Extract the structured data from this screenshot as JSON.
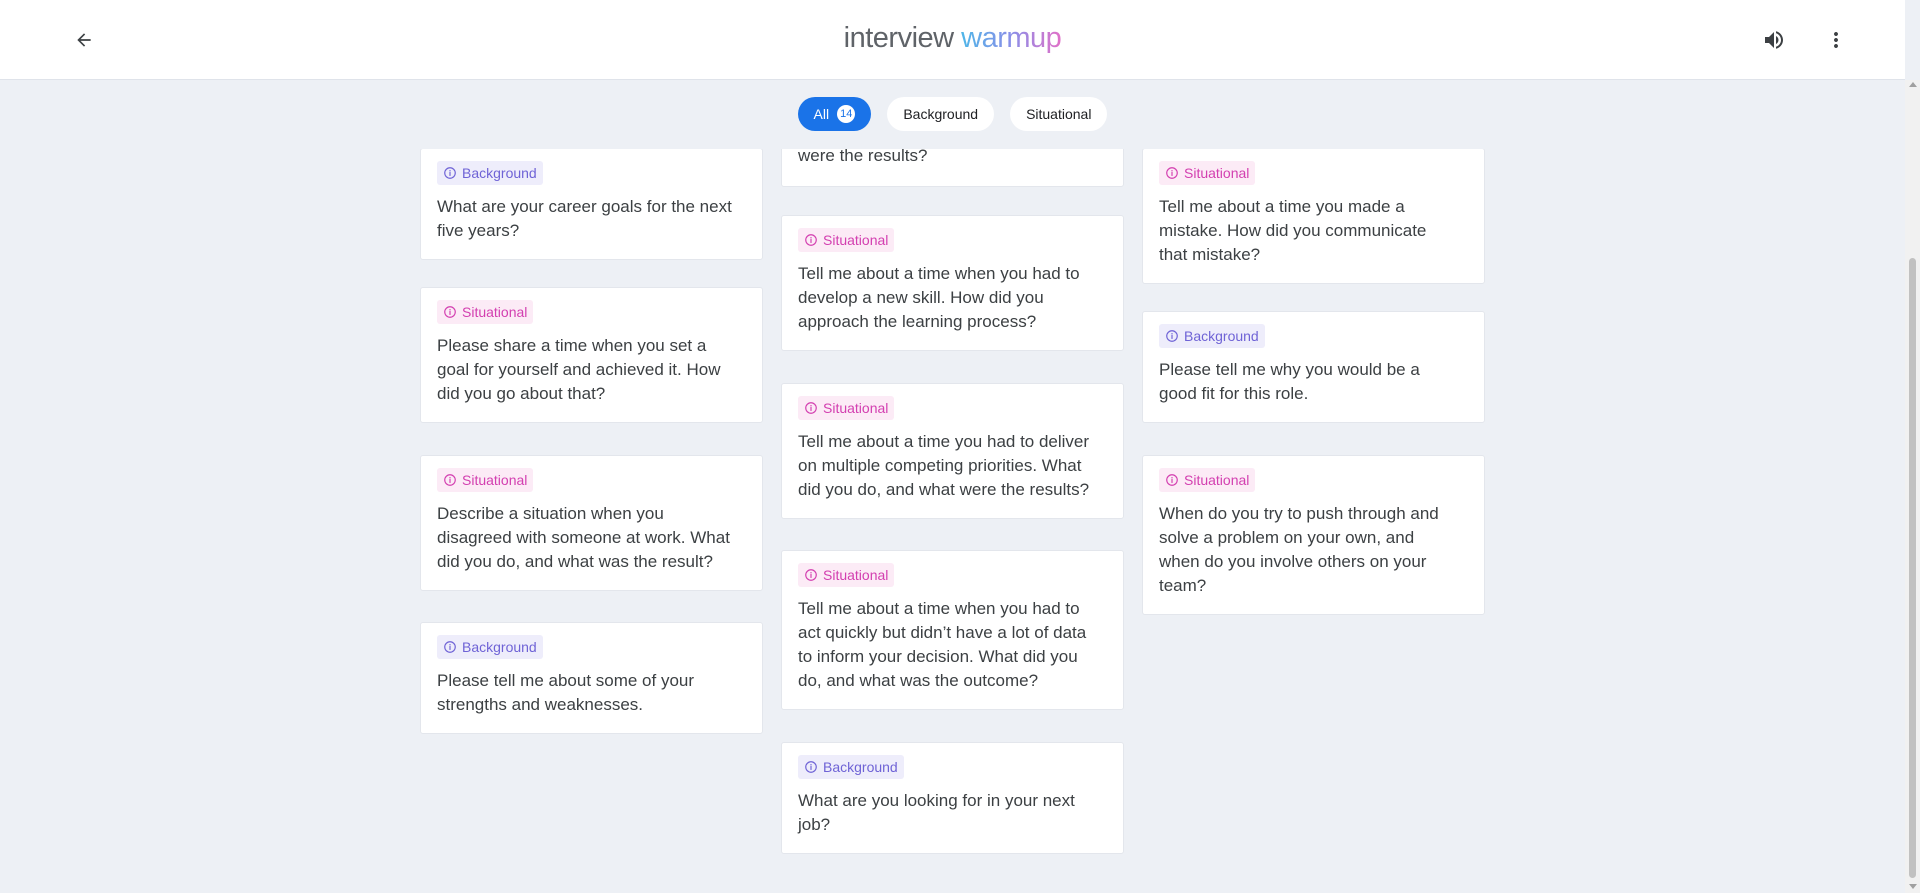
{
  "app": {
    "logo_part1": "interview",
    "logo_part2": "warmup"
  },
  "header": {
    "back_icon": "arrow-left-icon",
    "sound_icon": "volume-icon",
    "menu_icon": "more-vert-icon"
  },
  "filters": {
    "all_label": "All",
    "all_count": "14",
    "background_label": "Background",
    "situational_label": "Situational",
    "active": "All"
  },
  "colors": {
    "accent": "#1a73e8",
    "background_tag": "#6f63d6",
    "situational_tag": "#d33fb0"
  },
  "cards": [
    {
      "category": "Background",
      "question": "What are your career goals for the next five years?"
    },
    {
      "category": "Situational",
      "question": "Please share a time when you set a goal for yourself and achieved it. How did you go about that?"
    },
    {
      "category": "Situational",
      "question": "Describe a situation when you disagreed with someone at work. What did you do, and what was the result?"
    },
    {
      "category": "Background",
      "question": "Please tell me about some of your strengths and weaknesses."
    },
    {
      "category": "",
      "question": "were the results?"
    },
    {
      "category": "Situational",
      "question": "Tell me about a time when you had to develop a new skill. How did you approach the learning process?"
    },
    {
      "category": "Situational",
      "question": "Tell me about a time you had to deliver on multiple competing priorities. What did you do, and what were the results?"
    },
    {
      "category": "Situational",
      "question": "Tell me about a time when you had to act quickly but didn’t have a lot of data to inform your decision. What did you do, and what was the outcome?"
    },
    {
      "category": "Background",
      "question": "What are you looking for in your next job?"
    },
    {
      "category": "Situational",
      "question": "Tell me about a time you made a mistake. How did you communicate that mistake?"
    },
    {
      "category": "Background",
      "question": "Please tell me why you would be a good fit for this role."
    },
    {
      "category": "Situational",
      "question": "When do you try to push through and solve a problem on your own, and when do you involve others on your team?"
    }
  ]
}
